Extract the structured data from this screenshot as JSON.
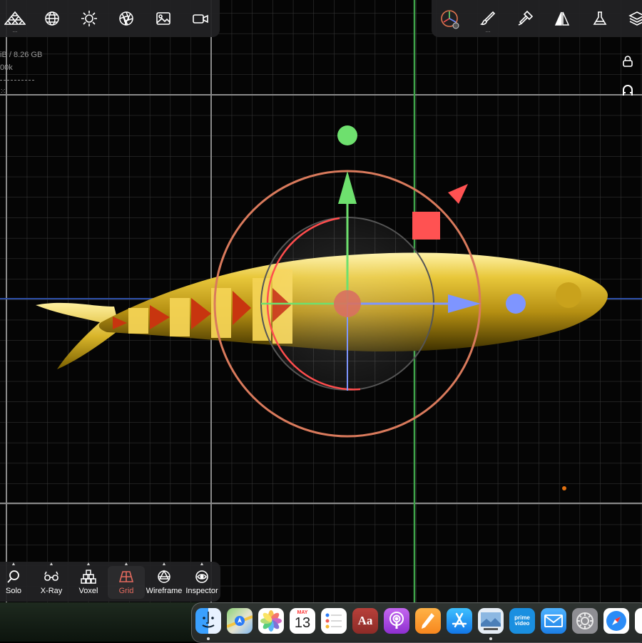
{
  "stats": {
    "memory": "iB / 8.26 GB",
    "polys": "00k"
  },
  "top_left_toolbar": {
    "icons": [
      "pyramid-stack-icon",
      "sphere-icon",
      "sun-icon",
      "aperture-icon",
      "image-icon",
      "video-camera-icon"
    ]
  },
  "top_right_toolbar": {
    "icons": [
      "gizmo-icon",
      "brush-icon",
      "stamp-icon",
      "symmetry-icon",
      "flask-icon",
      "layers-icon"
    ]
  },
  "side_icons": [
    "lock-icon",
    "magnet-icon"
  ],
  "bottom_toolbar": {
    "items": [
      {
        "label": "Solo",
        "icon": "magnifier-icon"
      },
      {
        "label": "X-Ray",
        "icon": "glasses-icon"
      },
      {
        "label": "Voxel",
        "icon": "cubes-icon"
      },
      {
        "label": "Grid",
        "icon": "grid-icon",
        "active": true
      },
      {
        "label": "Wireframe",
        "icon": "wire-sphere-icon"
      },
      {
        "label": "Inspector",
        "icon": "eye-icon"
      }
    ]
  },
  "dock": {
    "apps": [
      {
        "name": "Finder",
        "icon": "finder-icon"
      },
      {
        "name": "Maps",
        "icon": "maps-icon"
      },
      {
        "name": "Photos",
        "icon": "photos-icon"
      },
      {
        "name": "Calendar",
        "icon": "calendar-icon",
        "month": "MAY",
        "day": "13"
      },
      {
        "name": "Reminders",
        "icon": "reminders-icon"
      },
      {
        "name": "Dictionary",
        "icon": "dictionary-icon",
        "text": "Aa"
      },
      {
        "name": "Podcasts",
        "icon": "podcasts-icon"
      },
      {
        "name": "Pages",
        "icon": "pages-icon"
      },
      {
        "name": "App Store",
        "icon": "app-store-icon"
      },
      {
        "name": "Preview",
        "icon": "preview-icon"
      },
      {
        "name": "Prime Video",
        "icon": "prime-video-icon",
        "text": "prime video"
      },
      {
        "name": "Mail",
        "icon": "mail-icon"
      },
      {
        "name": "System Preferences",
        "icon": "system-preferences-icon"
      },
      {
        "name": "Safari",
        "icon": "safari-icon"
      }
    ]
  },
  "colors": {
    "toolbar_bg": "#222224",
    "active_accent": "#e56b5f",
    "fish_body": "#d4b020",
    "axis_x": "#6f8cff",
    "axis_y": "#6ee06e",
    "rotate_ring": "#d97a5c",
    "scale_handle": "#ff5252"
  }
}
